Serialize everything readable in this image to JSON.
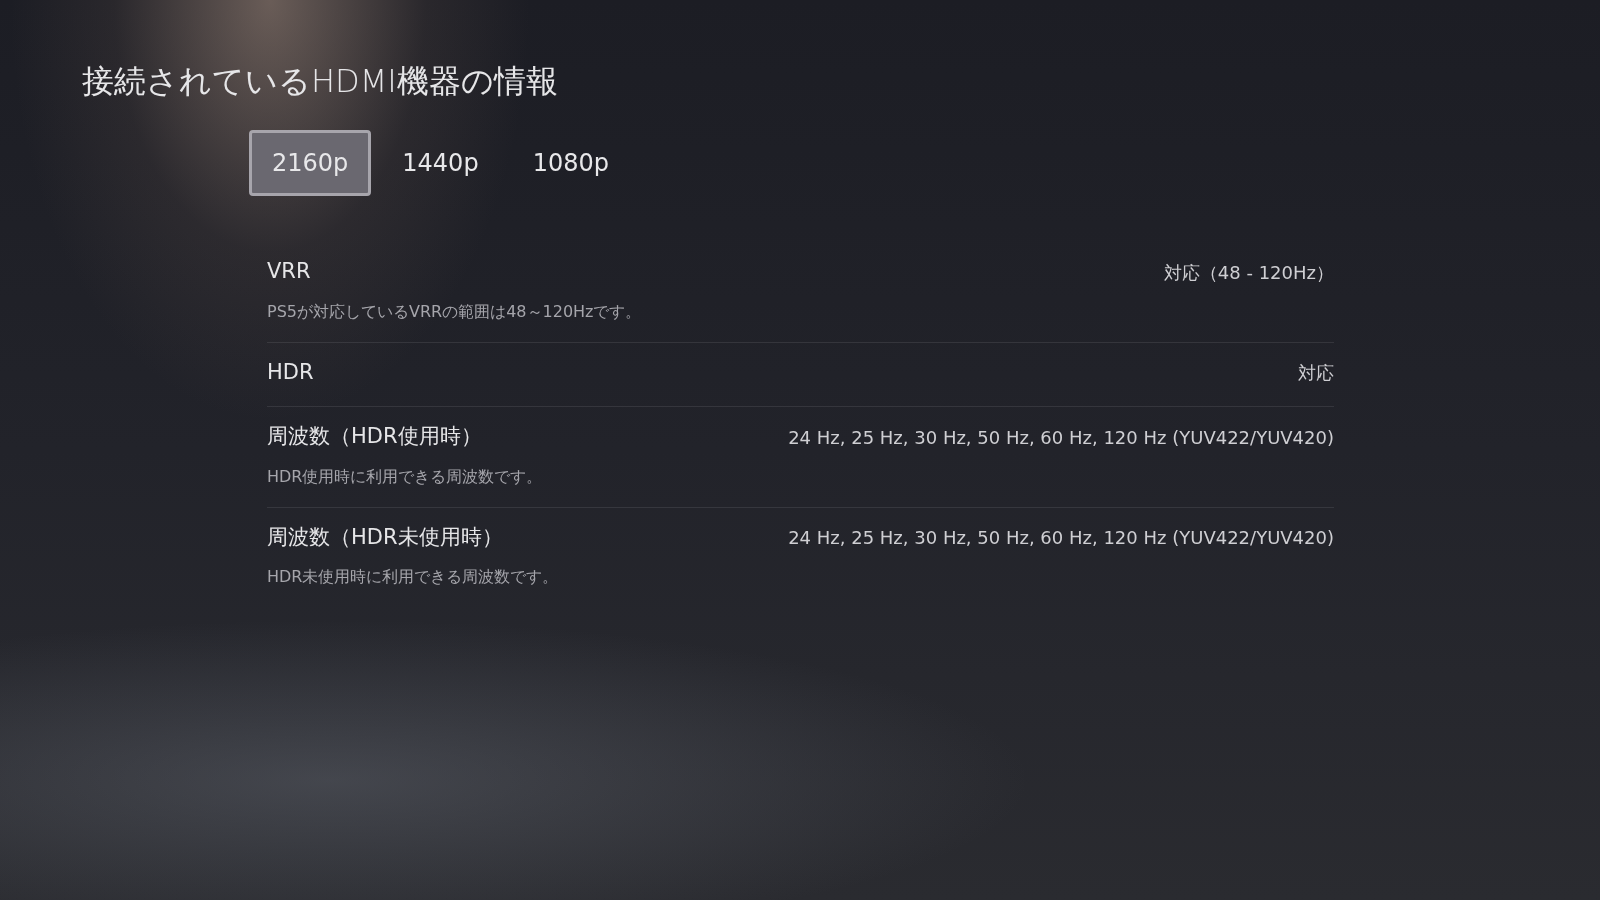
{
  "title": "接続されているHDMI機器の情報",
  "tabs": [
    {
      "label": "2160p",
      "selected": true
    },
    {
      "label": "1440p",
      "selected": false
    },
    {
      "label": "1080p",
      "selected": false
    }
  ],
  "rows": [
    {
      "label": "VRR",
      "value": "対応（48 - 120Hz）",
      "description": "PS5が対応しているVRRの範囲は48～120Hzです。"
    },
    {
      "label": "HDR",
      "value": "対応"
    },
    {
      "label": "周波数（HDR使用時）",
      "value": "24 Hz, 25 Hz, 30 Hz, 50 Hz, 60 Hz, 120 Hz (YUV422/YUV420)",
      "description": "HDR使用時に利用できる周波数です。"
    },
    {
      "label": "周波数（HDR未使用時）",
      "value": "24 Hz, 25 Hz, 30 Hz, 50 Hz, 60 Hz, 120 Hz (YUV422/YUV420)",
      "description": "HDR未使用時に利用できる周波数です。"
    }
  ]
}
